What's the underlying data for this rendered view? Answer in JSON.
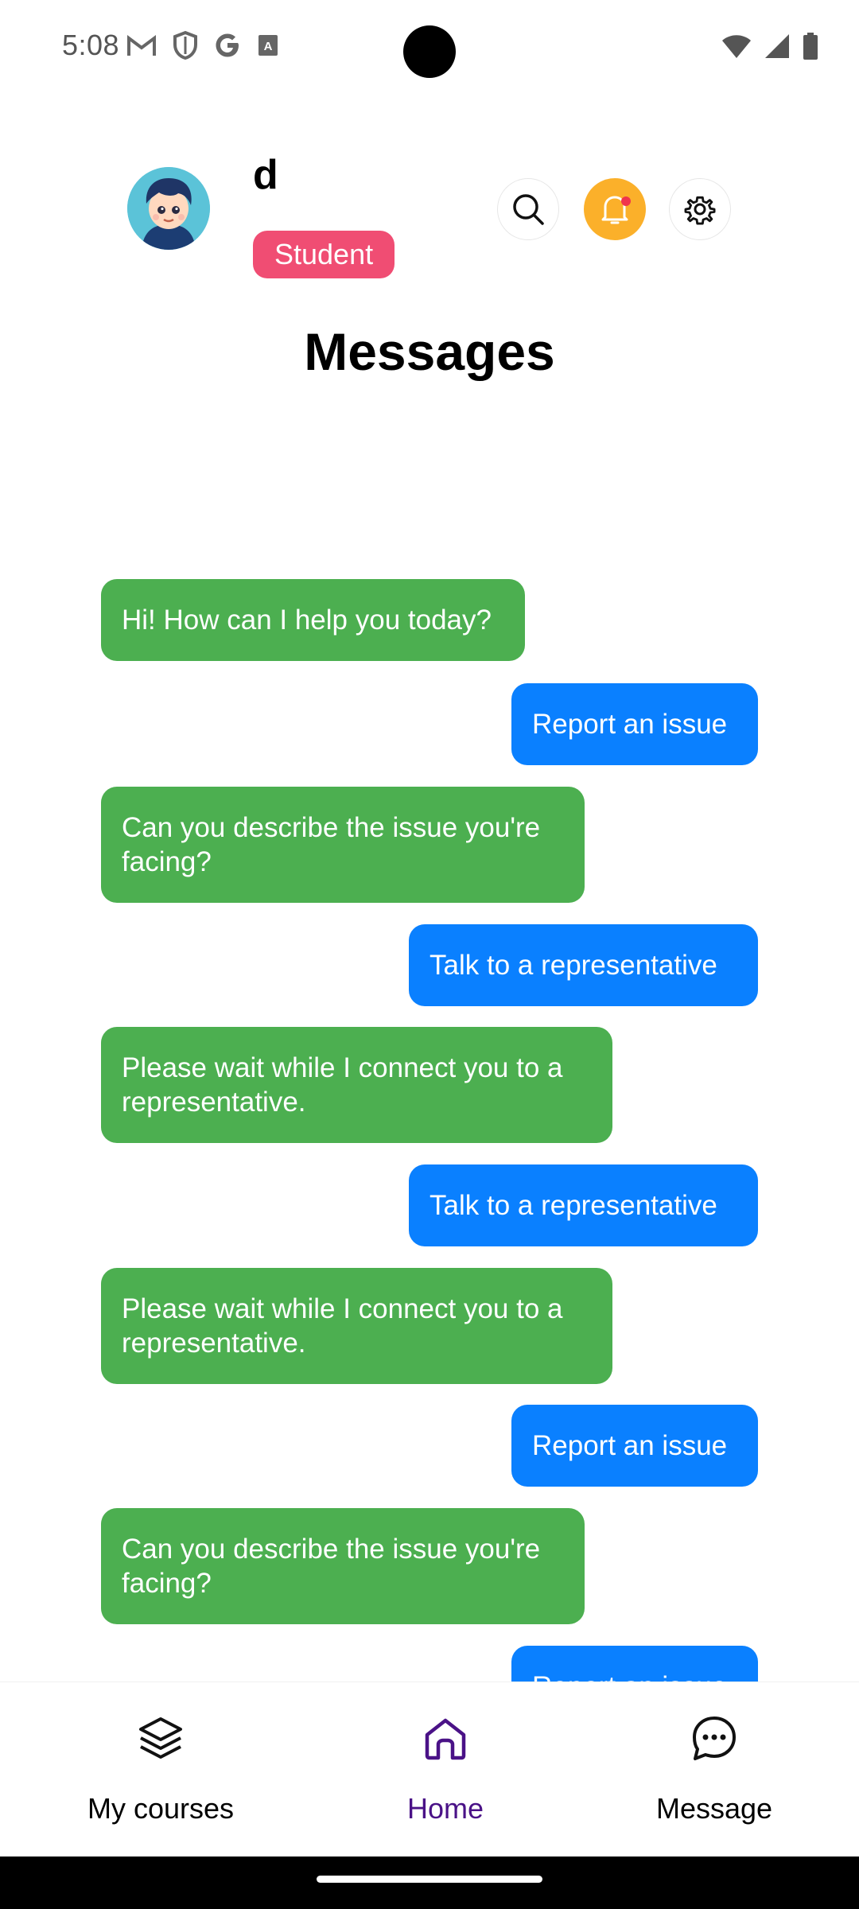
{
  "status_bar": {
    "time": "5:08",
    "left_icons": [
      "gmail-icon",
      "shield-icon",
      "google-icon",
      "text-icon"
    ],
    "right_icons": [
      "wifi-icon",
      "signal-icon",
      "battery-icon"
    ]
  },
  "header": {
    "user_name": "d",
    "role_badge": "Student",
    "role_badge_color": "#f04d73",
    "actions": [
      "search-icon",
      "bell-icon",
      "gear-icon"
    ],
    "bell_color": "#fbb02a"
  },
  "page_title": "Messages",
  "messages": [
    {
      "from": "bot",
      "text": "Hi! How can I help you today?"
    },
    {
      "from": "user",
      "text": "Report an issue"
    },
    {
      "from": "bot",
      "text": "Can you describe the issue you're facing?"
    },
    {
      "from": "user",
      "text": "Talk to a representative"
    },
    {
      "from": "bot",
      "text": "Please wait while I connect you to a representative."
    },
    {
      "from": "user",
      "text": "Talk to a representative"
    },
    {
      "from": "bot",
      "text": "Please wait while I connect you to a representative."
    },
    {
      "from": "user",
      "text": "Report an issue"
    },
    {
      "from": "bot",
      "text": "Can you describe the issue you're facing?"
    },
    {
      "from": "user",
      "text": "Report an issue"
    }
  ],
  "colors": {
    "bot_bubble": "#4caf50",
    "user_bubble": "#0a80ff",
    "active_nav": "#4a1287"
  },
  "bottom_nav": {
    "items": [
      {
        "label": "My courses",
        "icon": "layers-icon"
      },
      {
        "label": "Home",
        "icon": "home-icon",
        "active": true
      },
      {
        "label": "Message",
        "icon": "chat-icon"
      }
    ]
  }
}
